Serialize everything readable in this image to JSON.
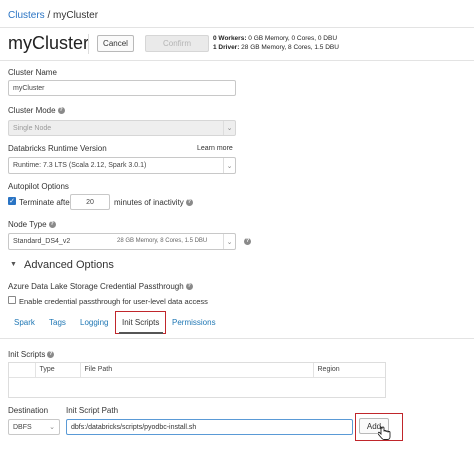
{
  "breadcrumb": {
    "root": "Clusters",
    "sep": " / ",
    "current": "myCluster"
  },
  "header": {
    "title": "myCluster",
    "cancel_label": "Cancel",
    "confirm_label": "Confirm",
    "workers_bold": "0 Workers:",
    "workers_rest": " 0 GB Memory, 0 Cores, 0 DBU",
    "driver_bold": "1 Driver:",
    "driver_rest": " 28 GB Memory, 8 Cores, 1.5 DBU"
  },
  "form": {
    "cluster_name_label": "Cluster Name",
    "cluster_name_value": "myCluster",
    "cluster_mode_label": "Cluster Mode",
    "cluster_mode_value": "Single Node",
    "runtime_label": "Databricks Runtime Version",
    "runtime_learn_more": "Learn more",
    "runtime_value": "Runtime: 7.3 LTS (Scala 2.12, Spark 3.0.1)",
    "autopilot_label": "Autopilot Options",
    "terminate_label": "Terminate after",
    "terminate_minutes": "20",
    "terminate_suffix": "minutes of inactivity",
    "node_type_label": "Node Type",
    "node_type_value": "Standard_DS4_v2",
    "node_type_spec": "28 GB Memory, 8 Cores, 1.5 DBU"
  },
  "advanced": {
    "title": "Advanced Options",
    "passthrough_label": "Azure Data Lake Storage Credential Passthrough",
    "passthrough_checkbox_label": "Enable credential passthrough for user-level data access",
    "tabs": [
      "Spark",
      "Tags",
      "Logging",
      "Init Scripts",
      "Permissions"
    ],
    "active_tab": "Init Scripts"
  },
  "init_scripts": {
    "section_label": "Init Scripts",
    "columns": [
      "",
      "Type",
      "File Path",
      "Region"
    ],
    "destination_label": "Destination",
    "destination_value": "DBFS",
    "path_label": "Init Script Path",
    "path_value": "dbfs:/databricks/scripts/pyodbc-install.sh",
    "add_label": "Add"
  },
  "colors": {
    "link": "#1f77b4",
    "highlight": "#c0262b",
    "checkbox": "#2a74c4"
  }
}
